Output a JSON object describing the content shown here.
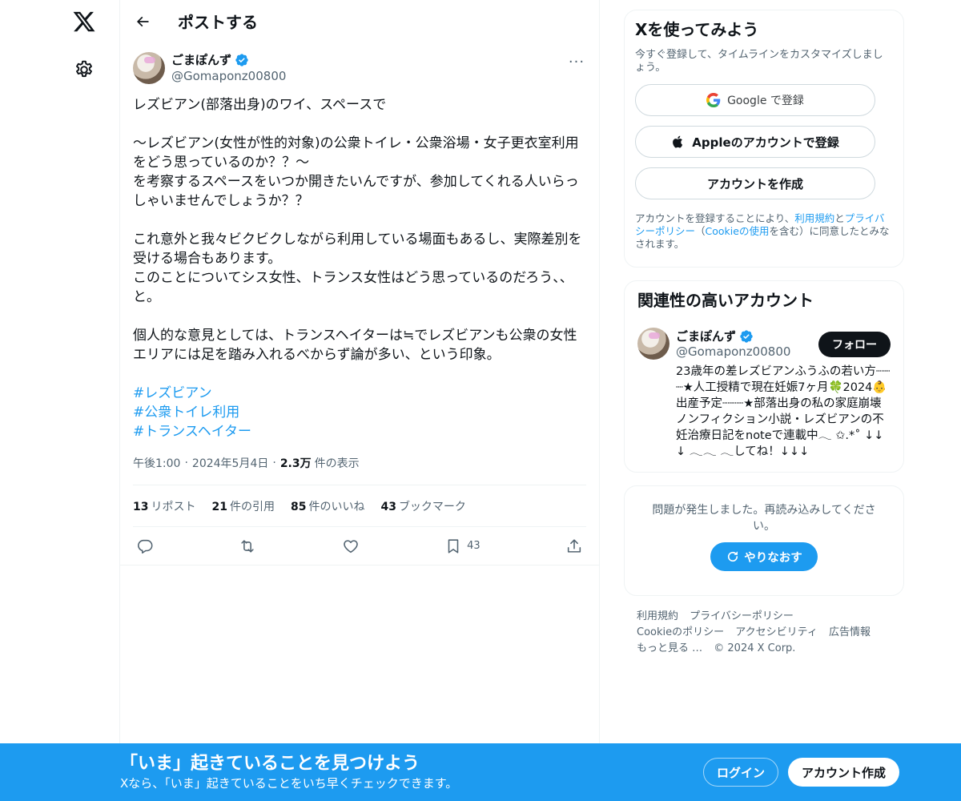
{
  "header": {
    "title": "ポストする"
  },
  "post": {
    "author_name": "ごまぽんず",
    "author_handle": "@Gomaponz00800",
    "text_lines": [
      "レズビアン(部落出身)のワイ、スペースで",
      "",
      "〜レズビアン(女性が性的対象)の公衆トイレ・公衆浴場・女子更衣室利用",
      "をどう思っているのか？？〜",
      "を考察するスペースをいつか開きたいんですが、参加してくれる人いらっ",
      "しゃいませんでしょうか？？",
      "",
      "これ意外と我々ビクビクしながら利用している場面もあるし、実際差別を",
      "受ける場合もあります。",
      "このことについてシス女性、トランス女性はどう思っているのだろう、、",
      "と。",
      "",
      "個人的な意見としては、トランスヘイターは≒でレズビアンも公衆の女性",
      "エリアには足を踏み入れるべからず論が多い、という印象。"
    ],
    "hashtags": [
      "#レズビアン",
      "#公衆トイレ利用",
      "#トランスヘイター"
    ],
    "time": "午後1:00",
    "date": "2024年5月4日",
    "views_count": "2.3万",
    "views_label": "件の表示",
    "stats": {
      "reposts_count": "13",
      "reposts_label": "リポスト",
      "quotes_count": "21",
      "quotes_label": "件の引用",
      "likes_count": "85",
      "likes_label": "件のいいね",
      "bookmarks_count": "43",
      "bookmarks_label": "ブックマーク"
    },
    "bookmark_action_count": "43",
    "more_glyph": "···"
  },
  "signup_card": {
    "title": "Xを使ってみよう",
    "subtitle": "今すぐ登録して、タイムラインをカスタマイズしましょう。",
    "google_button": "Google で登録",
    "apple_button": "Appleのアカウントで登録",
    "create_button": "アカウントを作成",
    "legal_prefix": "アカウントを登録することにより、",
    "legal_terms": "利用規約",
    "legal_and": "と",
    "legal_privacy": "プライバシーポリシー",
    "legal_paren_open": "（",
    "legal_cookie": "Cookieの使用",
    "legal_suffix": "を含む）に同意したとみなされます。"
  },
  "related_card": {
    "title": "関連性の高いアカウント",
    "account_name": "ごまぽんず",
    "account_handle": "@Gomaponz00800",
    "follow_button": "フォロー",
    "bio": "23歳年の差レズビアンふうふの若い方┈┈┈★人工授精で現在妊娠7ヶ月🍀2024👶出産予定┈┈┈★部落出身の私の家庭崩壊ノンフィクション小説・レズビアンの不妊治療日記をnoteで連載中𓂃 ✩.*˚ ↓↓↓ 𓂃𓂃 𓂃してね！↓↓↓"
  },
  "error_card": {
    "message": "問題が発生しました。再読み込みしてください。",
    "retry_button": "やりなおす"
  },
  "footer": {
    "links": [
      "利用規約",
      "プライバシーポリシー",
      "Cookieのポリシー",
      "アクセシビリティ",
      "広告情報",
      "もっと見る …"
    ],
    "copyright": "© 2024 X Corp."
  },
  "banner": {
    "title": "「いま」起きていることを見つけよう",
    "subtitle": "Xなら、「いま」起きていることをいち早くチェックできます。",
    "login_button": "ログイン",
    "signup_button": "アカウント作成"
  },
  "colors": {
    "accent": "#1d9bf0",
    "text": "#0f1419",
    "muted": "#536471",
    "border": "#eff3f4"
  },
  "icons": [
    "x-logo-icon",
    "gear-icon",
    "back-arrow-icon",
    "verified-badge-icon",
    "more-icon",
    "reply-icon",
    "repost-icon",
    "like-icon",
    "bookmark-icon",
    "share-icon",
    "google-icon",
    "apple-icon",
    "refresh-icon"
  ]
}
